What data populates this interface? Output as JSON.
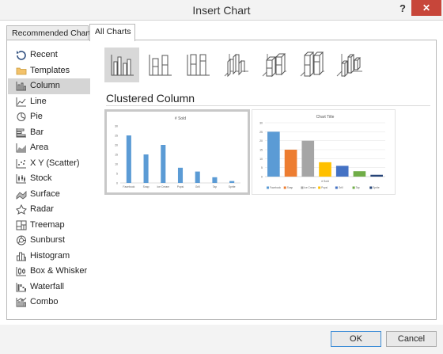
{
  "window": {
    "title": "Insert Chart",
    "help_label": "?",
    "close_label": "✕"
  },
  "tabs": [
    {
      "label": "Recommended Charts"
    },
    {
      "label": "All Charts"
    }
  ],
  "sidebar": {
    "items": [
      {
        "label": "Recent",
        "icon": "recent-icon"
      },
      {
        "label": "Templates",
        "icon": "folder-icon"
      },
      {
        "label": "Column",
        "icon": "column-chart-icon",
        "selected": true
      },
      {
        "label": "Line",
        "icon": "line-chart-icon"
      },
      {
        "label": "Pie",
        "icon": "pie-chart-icon"
      },
      {
        "label": "Bar",
        "icon": "bar-chart-icon"
      },
      {
        "label": "Area",
        "icon": "area-chart-icon"
      },
      {
        "label": "X Y (Scatter)",
        "icon": "scatter-chart-icon"
      },
      {
        "label": "Stock",
        "icon": "stock-chart-icon"
      },
      {
        "label": "Surface",
        "icon": "surface-chart-icon"
      },
      {
        "label": "Radar",
        "icon": "radar-chart-icon"
      },
      {
        "label": "Treemap",
        "icon": "treemap-chart-icon"
      },
      {
        "label": "Sunburst",
        "icon": "sunburst-chart-icon"
      },
      {
        "label": "Histogram",
        "icon": "histogram-chart-icon"
      },
      {
        "label": "Box & Whisker",
        "icon": "box-whisker-chart-icon"
      },
      {
        "label": "Waterfall",
        "icon": "waterfall-chart-icon"
      },
      {
        "label": "Combo",
        "icon": "combo-chart-icon"
      }
    ]
  },
  "subtypes": [
    {
      "icon": "clustered-column-icon",
      "selected": true
    },
    {
      "icon": "stacked-column-icon"
    },
    {
      "icon": "100-stacked-column-icon"
    },
    {
      "icon": "3d-clustered-column-icon"
    },
    {
      "icon": "3d-stacked-column-icon"
    },
    {
      "icon": "3d-100-stacked-column-icon"
    },
    {
      "icon": "3d-column-icon"
    }
  ],
  "section_title": "Clustered Column",
  "colors": {
    "accent_blue": "#5b9bd5",
    "orange": "#ed7d31",
    "gray": "#a5a5a5",
    "gold": "#ffc000",
    "dark_blue": "#4472c4",
    "green": "#70ad47",
    "navy": "#264478"
  },
  "chart_data": [
    {
      "type": "bar",
      "title": "# Sold",
      "categories": [
        "Facebook",
        "Snap",
        "Ice Cream",
        "Popsi",
        "Grill",
        "Tap",
        "Sprite"
      ],
      "values": [
        25,
        15,
        20,
        8,
        6,
        3,
        1
      ],
      "ylim": [
        0,
        30
      ],
      "yticks": [
        "0",
        "5",
        "10",
        "15",
        "20",
        "25",
        "30"
      ],
      "grid": false,
      "legend": "none"
    },
    {
      "type": "bar",
      "title": "Chart Title",
      "categories": [
        "Facebook",
        "Snap",
        "Ice Cream",
        "Popsi",
        "Grill",
        "Tap",
        "Sprite"
      ],
      "values": [
        25,
        15,
        20,
        8,
        6,
        3,
        1
      ],
      "ylim": [
        0,
        30
      ],
      "yticks": [
        "0",
        "5",
        "10",
        "15",
        "20",
        "25",
        "30"
      ],
      "xlabel": "# Sold",
      "grid": true,
      "legend": "bottom"
    }
  ],
  "buttons": {
    "ok": "OK",
    "cancel": "Cancel"
  }
}
